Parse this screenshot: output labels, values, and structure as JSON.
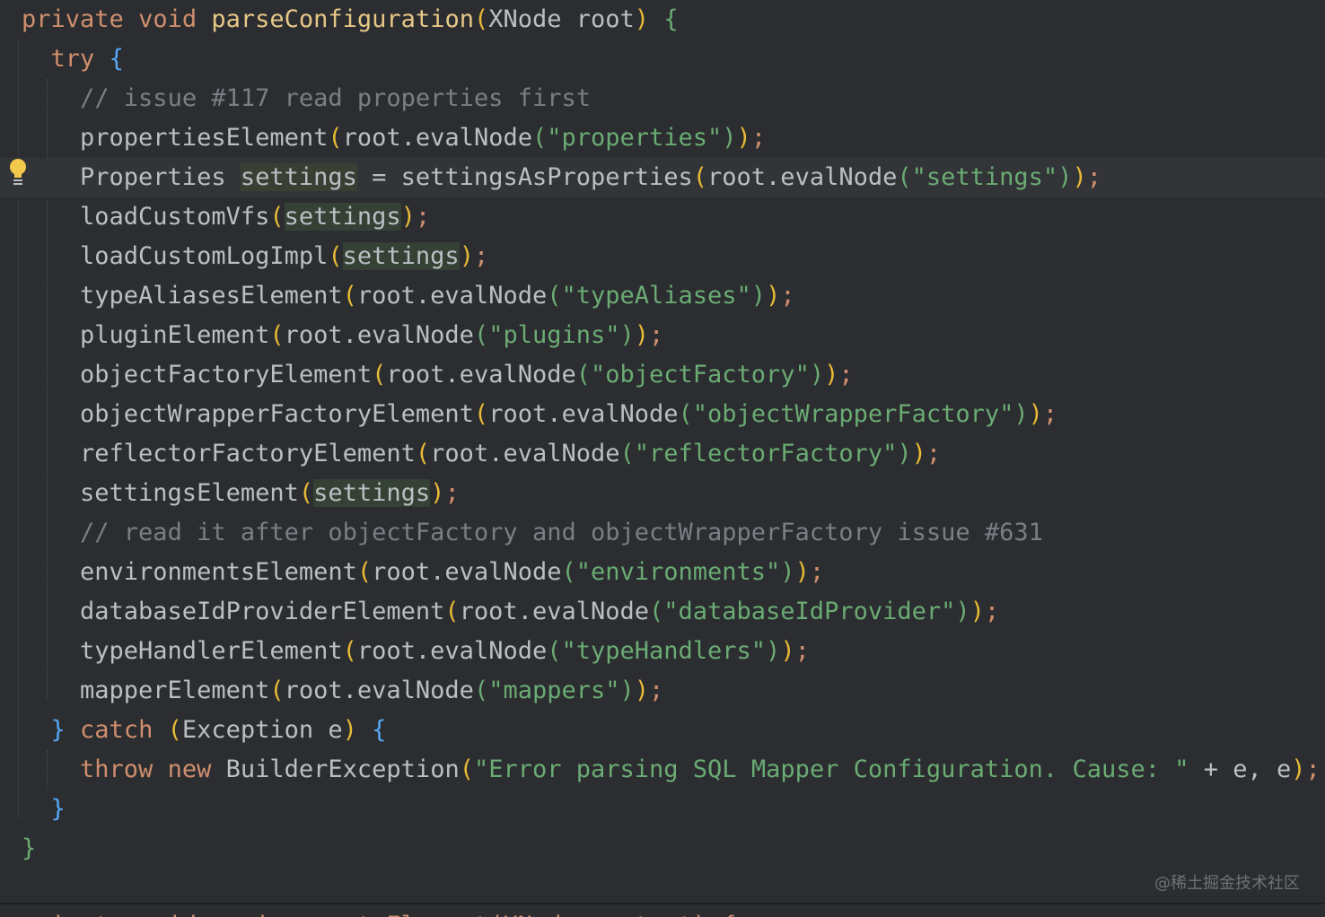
{
  "editor": {
    "lines": [
      {
        "tokens": [
          [
            "kw",
            "private"
          ],
          [
            "punc",
            " "
          ],
          [
            "kw",
            "void"
          ],
          [
            "punc",
            " "
          ],
          [
            "fnY",
            "parseConfiguration"
          ],
          [
            "paren",
            "("
          ],
          [
            "punc",
            "XNode root"
          ],
          [
            "paren",
            ")"
          ],
          [
            "punc",
            " "
          ],
          [
            "brace-g",
            "{"
          ]
        ]
      },
      {
        "tokens": [
          [
            "punc",
            "  "
          ],
          [
            "kw",
            "try"
          ],
          [
            "punc",
            " "
          ],
          [
            "brace-b",
            "{"
          ]
        ]
      },
      {
        "tokens": [
          [
            "punc",
            "    "
          ],
          [
            "cm",
            "// issue #117 read properties first"
          ]
        ]
      },
      {
        "tokens": [
          [
            "punc",
            "    propertiesElement"
          ],
          [
            "paren",
            "("
          ],
          [
            "punc",
            "root.evalNode"
          ],
          [
            "str",
            "(\"properties\")"
          ],
          [
            "paren",
            ")"
          ],
          [
            "kw",
            ";"
          ]
        ]
      },
      {
        "tokens": [
          [
            "punc",
            "    Properties "
          ],
          [
            "var-hl2",
            "settings"
          ],
          [
            "punc",
            " = settingsAsProperties"
          ],
          [
            "paren",
            "("
          ],
          [
            "punc",
            "root.evalNode"
          ],
          [
            "str",
            "(\"settings\")"
          ],
          [
            "paren",
            ")"
          ],
          [
            "kw",
            ";"
          ]
        ],
        "current": true
      },
      {
        "tokens": [
          [
            "punc",
            "    loadCustomVfs"
          ],
          [
            "paren",
            "("
          ],
          [
            "var-hl",
            "settings"
          ],
          [
            "paren",
            ")"
          ],
          [
            "kw",
            ";"
          ]
        ]
      },
      {
        "tokens": [
          [
            "punc",
            "    loadCustomLogImpl"
          ],
          [
            "paren",
            "("
          ],
          [
            "var-hl",
            "settings"
          ],
          [
            "paren",
            ")"
          ],
          [
            "kw",
            ";"
          ]
        ]
      },
      {
        "tokens": [
          [
            "punc",
            "    typeAliasesElement"
          ],
          [
            "paren",
            "("
          ],
          [
            "punc",
            "root.evalNode"
          ],
          [
            "str",
            "(\"typeAliases\")"
          ],
          [
            "paren",
            ")"
          ],
          [
            "kw",
            ";"
          ]
        ]
      },
      {
        "tokens": [
          [
            "punc",
            "    pluginElement"
          ],
          [
            "paren",
            "("
          ],
          [
            "punc",
            "root.evalNode"
          ],
          [
            "str",
            "(\"plugins\")"
          ],
          [
            "paren",
            ")"
          ],
          [
            "kw",
            ";"
          ]
        ]
      },
      {
        "tokens": [
          [
            "punc",
            "    objectFactoryElement"
          ],
          [
            "paren",
            "("
          ],
          [
            "punc",
            "root.evalNode"
          ],
          [
            "str",
            "(\"objectFactory\")"
          ],
          [
            "paren",
            ")"
          ],
          [
            "kw",
            ";"
          ]
        ]
      },
      {
        "tokens": [
          [
            "punc",
            "    objectWrapperFactoryElement"
          ],
          [
            "paren",
            "("
          ],
          [
            "punc",
            "root.evalNode"
          ],
          [
            "str",
            "(\"objectWrapperFactory\")"
          ],
          [
            "paren",
            ")"
          ],
          [
            "kw",
            ";"
          ]
        ]
      },
      {
        "tokens": [
          [
            "punc",
            "    reflectorFactoryElement"
          ],
          [
            "paren",
            "("
          ],
          [
            "punc",
            "root.evalNode"
          ],
          [
            "str",
            "(\"reflectorFactory\")"
          ],
          [
            "paren",
            ")"
          ],
          [
            "kw",
            ";"
          ]
        ]
      },
      {
        "tokens": [
          [
            "punc",
            "    settingsElement"
          ],
          [
            "paren",
            "("
          ],
          [
            "var-hl",
            "settings"
          ],
          [
            "paren",
            ")"
          ],
          [
            "kw",
            ";"
          ]
        ]
      },
      {
        "tokens": [
          [
            "punc",
            "    "
          ],
          [
            "cm",
            "// read it after objectFactory and objectWrapperFactory issue #631"
          ]
        ]
      },
      {
        "tokens": [
          [
            "punc",
            "    environmentsElement"
          ],
          [
            "paren",
            "("
          ],
          [
            "punc",
            "root.evalNode"
          ],
          [
            "str",
            "(\"environments\")"
          ],
          [
            "paren",
            ")"
          ],
          [
            "kw",
            ";"
          ]
        ]
      },
      {
        "tokens": [
          [
            "punc",
            "    databaseIdProviderElement"
          ],
          [
            "paren",
            "("
          ],
          [
            "punc",
            "root.evalNode"
          ],
          [
            "str",
            "(\"databaseIdProvider\")"
          ],
          [
            "paren",
            ")"
          ],
          [
            "kw",
            ";"
          ]
        ]
      },
      {
        "tokens": [
          [
            "punc",
            "    typeHandlerElement"
          ],
          [
            "paren",
            "("
          ],
          [
            "punc",
            "root.evalNode"
          ],
          [
            "str",
            "(\"typeHandlers\")"
          ],
          [
            "paren",
            ")"
          ],
          [
            "kw",
            ";"
          ]
        ]
      },
      {
        "tokens": [
          [
            "punc",
            "    mapperElement"
          ],
          [
            "paren",
            "("
          ],
          [
            "punc",
            "root.evalNode"
          ],
          [
            "str",
            "(\"mappers\")"
          ],
          [
            "paren",
            ")"
          ],
          [
            "kw",
            ";"
          ]
        ]
      },
      {
        "tokens": [
          [
            "punc",
            "  "
          ],
          [
            "brace-b",
            "}"
          ],
          [
            "punc",
            " "
          ],
          [
            "kw",
            "catch"
          ],
          [
            "punc",
            " "
          ],
          [
            "paren",
            "("
          ],
          [
            "punc",
            "Exception e"
          ],
          [
            "paren",
            ")"
          ],
          [
            "punc",
            " "
          ],
          [
            "brace-b",
            "{"
          ]
        ]
      },
      {
        "tokens": [
          [
            "punc",
            "    "
          ],
          [
            "kw",
            "throw"
          ],
          [
            "punc",
            " "
          ],
          [
            "kw",
            "new"
          ],
          [
            "punc",
            " BuilderException"
          ],
          [
            "paren",
            "("
          ],
          [
            "str",
            "\"Error parsing SQL Mapper Configuration. Cause: \""
          ],
          [
            "punc",
            " + e, e"
          ],
          [
            "paren",
            ")"
          ],
          [
            "kw",
            ";"
          ]
        ]
      },
      {
        "tokens": [
          [
            "punc",
            "  "
          ],
          [
            "brace-b",
            "}"
          ]
        ]
      },
      {
        "tokens": [
          [
            "brace-g",
            "}"
          ]
        ]
      }
    ],
    "intention_icon": "lightbulb-icon"
  },
  "watermark": "@稀土掘金技术社区",
  "colors": {
    "background": "#2b2d30",
    "keyword": "#cf8e6d",
    "string": "#6aab73",
    "comment": "#7a7e85",
    "method_decl": "#e7c787",
    "brace": "#56a8f5"
  }
}
